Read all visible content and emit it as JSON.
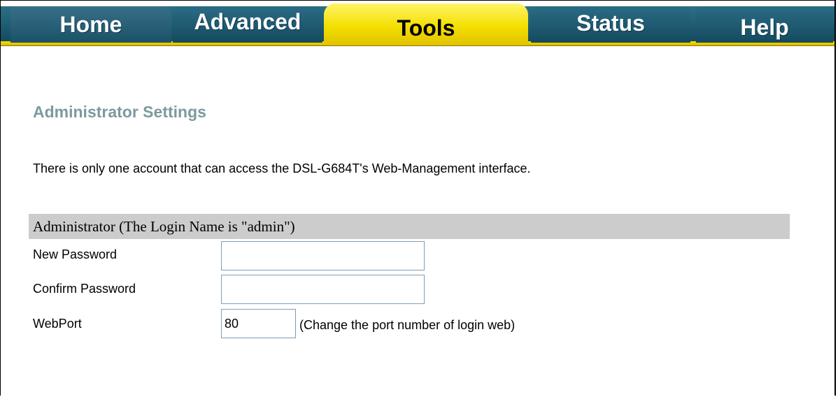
{
  "nav": {
    "tabs": [
      {
        "label": "Home",
        "active": false
      },
      {
        "label": "Advanced",
        "active": false
      },
      {
        "label": "Tools",
        "active": true
      },
      {
        "label": "Status",
        "active": false
      },
      {
        "label": "Help",
        "active": false
      }
    ]
  },
  "main": {
    "title": "Administrator Settings",
    "intro": "There is only one account that can access the DSL-G684T's Web-Management interface.",
    "section_header": "Administrator (The Login Name is \"admin\")",
    "fields": {
      "new_password": {
        "label": "New Password",
        "value": ""
      },
      "confirm_password": {
        "label": "Confirm Password",
        "value": ""
      },
      "webport": {
        "label": "WebPort",
        "value": "80",
        "hint": "(Change the port number of login web)"
      }
    }
  },
  "colors": {
    "tab_blue": "#1f5d74",
    "tab_active_yellow": "#f3df00",
    "title_color": "#7c9aa0",
    "section_gray": "#cccccc"
  }
}
